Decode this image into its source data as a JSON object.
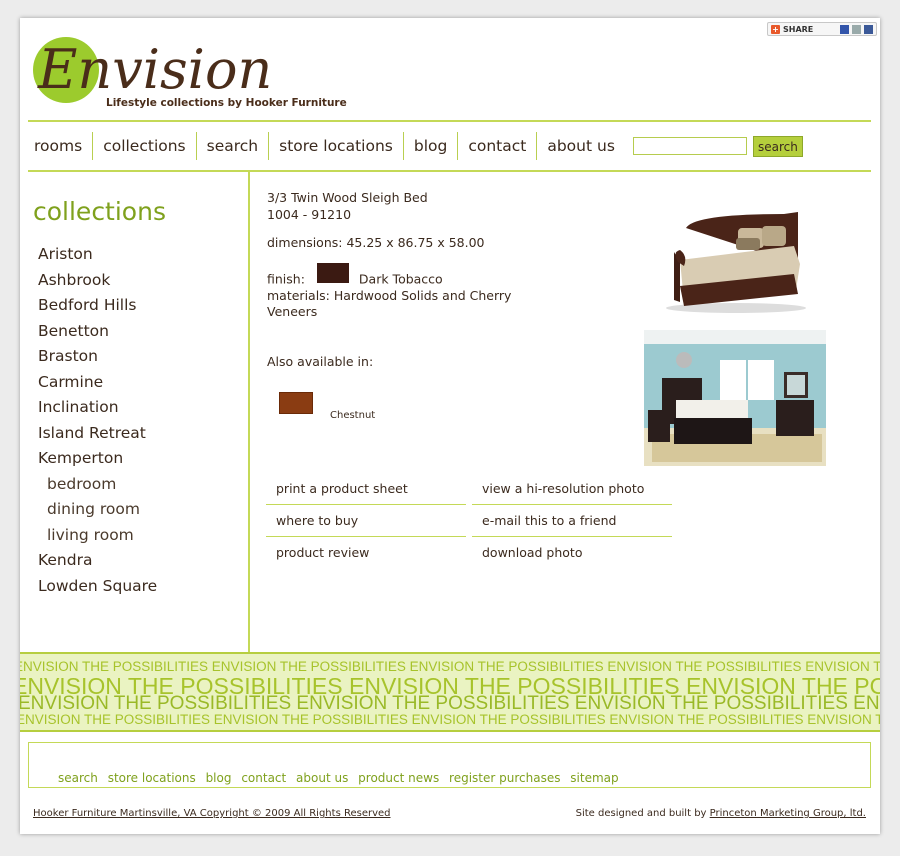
{
  "share": {
    "label": "SHARE"
  },
  "logo": {
    "wordmark": "Envision",
    "tagline": "Lifestyle collections by Hooker Furniture"
  },
  "nav": {
    "items": [
      "rooms",
      "collections",
      "search",
      "store locations",
      "blog",
      "contact",
      "about us"
    ],
    "search_value": "",
    "search_button": "search"
  },
  "sidebar": {
    "title": "collections",
    "items": [
      "Ariston",
      "Ashbrook",
      "Bedford Hills",
      "Benetton",
      "Braston",
      "Carmine",
      "Inclination",
      "Island Retreat",
      "Kemperton"
    ],
    "subitems": [
      "bedroom",
      "dining room",
      "living room"
    ],
    "items_after": [
      "Kendra",
      "Lowden Square"
    ]
  },
  "product": {
    "name": "3/3 Twin Wood Sleigh Bed",
    "sku": "1004 - 91210",
    "dimensions": "dimensions: 45.25 x 86.75 x 58.00",
    "finish_label": "finish:",
    "finish_value": "Dark Tobacco",
    "materials": "materials: Hardwood Solids and Cherry Veneers",
    "also_label": "Also available in:",
    "also_finish": "Chestnut"
  },
  "actions": [
    [
      "print a product sheet",
      "view a hi-resolution photo"
    ],
    [
      "where to buy",
      "e-mail this to a friend"
    ],
    [
      "product review",
      "download photo"
    ]
  ],
  "banner": {
    "line": "ENVISION THE POSSIBILITIES "
  },
  "footer": {
    "links": [
      "search",
      "store locations",
      "blog",
      "contact",
      "about us",
      "product news",
      "register purchases",
      "sitemap"
    ],
    "copyright": "Hooker Furniture Martinsville, VA Copyright © 2009 All Rights Reserved",
    "credit_prefix": "Site designed and built by",
    "credit_link": "Princeton Marketing Group, ltd."
  },
  "colors": {
    "accent": "#c4d957",
    "heading": "#7fa11d",
    "text": "#3b2a1e"
  }
}
